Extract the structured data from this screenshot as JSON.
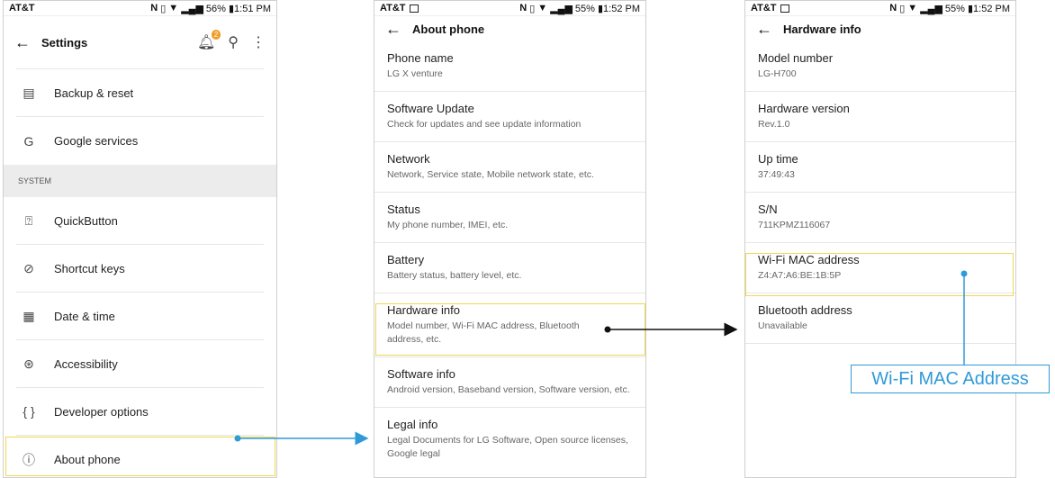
{
  "screen1": {
    "carrier": "AT&T",
    "status": "56% ▮1:51 PM",
    "title": "Settings",
    "badge": "2",
    "rows_top": [
      {
        "label": "Backup & reset",
        "icon": "backup-icon"
      },
      {
        "label": "Google services",
        "icon": "google-g-icon"
      }
    ],
    "section": "SYSTEM",
    "rows": [
      {
        "label": "QuickButton",
        "icon": "quickbutton-icon"
      },
      {
        "label": "Shortcut keys",
        "icon": "shortcut-icon"
      },
      {
        "label": "Date & time",
        "icon": "calendar-icon"
      },
      {
        "label": "Accessibility",
        "icon": "accessibility-icon"
      },
      {
        "label": "Developer options",
        "icon": "braces-icon"
      },
      {
        "label": "About phone",
        "icon": "info-icon"
      }
    ]
  },
  "screen2": {
    "carrier": "AT&T",
    "status": "55% ▮1:52 PM",
    "title": "About phone",
    "items": [
      {
        "title": "Phone name",
        "sub": "LG X venture"
      },
      {
        "title": "Software Update",
        "sub": "Check for updates and see update information"
      },
      {
        "title": "Network",
        "sub": "Network, Service state, Mobile network state, etc."
      },
      {
        "title": "Status",
        "sub": "My phone number, IMEI, etc."
      },
      {
        "title": "Battery",
        "sub": "Battery status, battery level, etc."
      },
      {
        "title": "Hardware info",
        "sub": "Model number, Wi-Fi MAC address, Bluetooth address, etc."
      },
      {
        "title": "Software info",
        "sub": "Android version, Baseband version, Software version, etc."
      },
      {
        "title": "Legal info",
        "sub": "Legal Documents for LG Software, Open source licenses, Google legal"
      }
    ]
  },
  "screen3": {
    "carrier": "AT&T",
    "status": "55% ▮1:52 PM",
    "title": "Hardware info",
    "items": [
      {
        "title": "Model number",
        "sub": "LG-H700"
      },
      {
        "title": "Hardware version",
        "sub": "Rev.1.0"
      },
      {
        "title": "Up time",
        "sub": "37:49:43"
      },
      {
        "title": "S/N",
        "sub": "711KPMZ116067"
      },
      {
        "title": "Wi-Fi MAC address",
        "sub": "Z4:A7:A6:BE:1B:5P"
      },
      {
        "title": "Bluetooth address",
        "sub": "Unavailable"
      }
    ]
  },
  "annotation": {
    "callout": "Wi-Fi MAC Address",
    "callout_color": "#2f9ad8",
    "highlight_color": "#f0d850",
    "arrow_color_blue": "#2f9ad8",
    "arrow_color_black": "#111111"
  }
}
